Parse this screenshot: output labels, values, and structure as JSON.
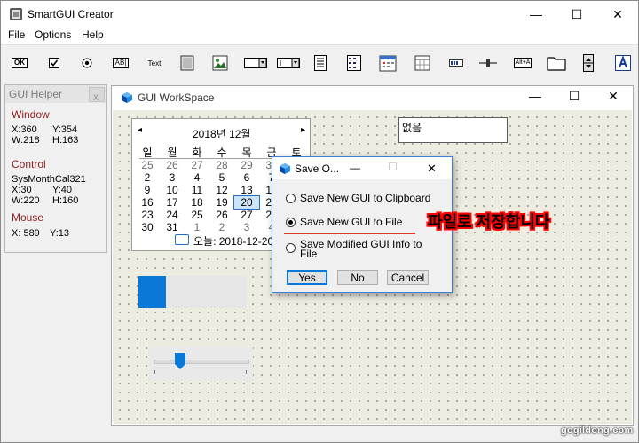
{
  "app": {
    "title": "SmartGUI Creator",
    "minimize": "—",
    "maximize": "☐",
    "close": "✕"
  },
  "menu": [
    "File",
    "Options",
    "Help"
  ],
  "toolbar": {
    "ok": "OK",
    "edit": "AB|",
    "text": "Text",
    "alt": "Alt+A",
    "icons": [
      "button-ok-icon",
      "checkbox-icon",
      "radio-icon",
      "edit-field-icon",
      "text-label-icon",
      "groupbox-icon",
      "picture-icon",
      "dropdown-icon",
      "combobox-icon",
      "listbox-icon",
      "listview-icon",
      "datetime-icon",
      "monthcal-icon",
      "progress-icon",
      "slider-icon",
      "hotkey-icon",
      "folder-icon",
      "updown-icon",
      "help-icon"
    ]
  },
  "helper": {
    "title": "GUI Helper",
    "close": "x",
    "window_label": "Window",
    "window_x": "X:360",
    "window_y": "Y:354",
    "window_w": "W:218",
    "window_h": "H:163",
    "control_label": "Control",
    "control_name": "SysMonthCal321",
    "control_x": "X:30",
    "control_y": "Y:40",
    "control_w": "W:220",
    "control_h": "H:160",
    "mouse_label": "Mouse",
    "mouse_x": "X: 589",
    "mouse_y": "Y:13"
  },
  "workspace": {
    "title": "GUI WorkSpace",
    "minimize": "—",
    "maximize": "☐",
    "close": "✕"
  },
  "calendar": {
    "month": "2018년 12월",
    "prev": "◂",
    "next": "▸",
    "days": [
      "일",
      "월",
      "화",
      "수",
      "목",
      "금",
      "토"
    ],
    "rows": [
      [
        "25",
        "26",
        "27",
        "28",
        "29",
        "30",
        ""
      ],
      [
        "2",
        "3",
        "4",
        "5",
        "6",
        "7",
        ""
      ],
      [
        "9",
        "10",
        "11",
        "12",
        "13",
        "14",
        ""
      ],
      [
        "16",
        "17",
        "18",
        "19",
        "20",
        "21",
        ""
      ],
      [
        "23",
        "24",
        "25",
        "26",
        "27",
        "28",
        ""
      ],
      [
        "30",
        "31",
        "1",
        "2",
        "3",
        "4",
        ""
      ]
    ],
    "today_label": "오늘: 2018-12-20"
  },
  "none_box": {
    "text": "없음"
  },
  "progress": {
    "value": 0.25
  },
  "slider": {
    "value": 0.25
  },
  "dialog": {
    "title": "Save O...",
    "minimize": "—",
    "maximize": "☐",
    "close": "✕",
    "options": [
      "Save New GUI to Clipboard",
      "Save New GUI to File",
      "Save Modified GUI Info to",
      "File"
    ],
    "selected": "Save New GUI to File",
    "yes": "Yes",
    "no": "No",
    "cancel": "Cancel"
  },
  "annotation": "파일로 저장합니다",
  "watermark": "gogildong.com",
  "colors": {
    "accent": "#0a78d7",
    "helper_section": "#8b1c1c",
    "annotation_stroke": "#ff0000",
    "underline": "#e03030"
  }
}
